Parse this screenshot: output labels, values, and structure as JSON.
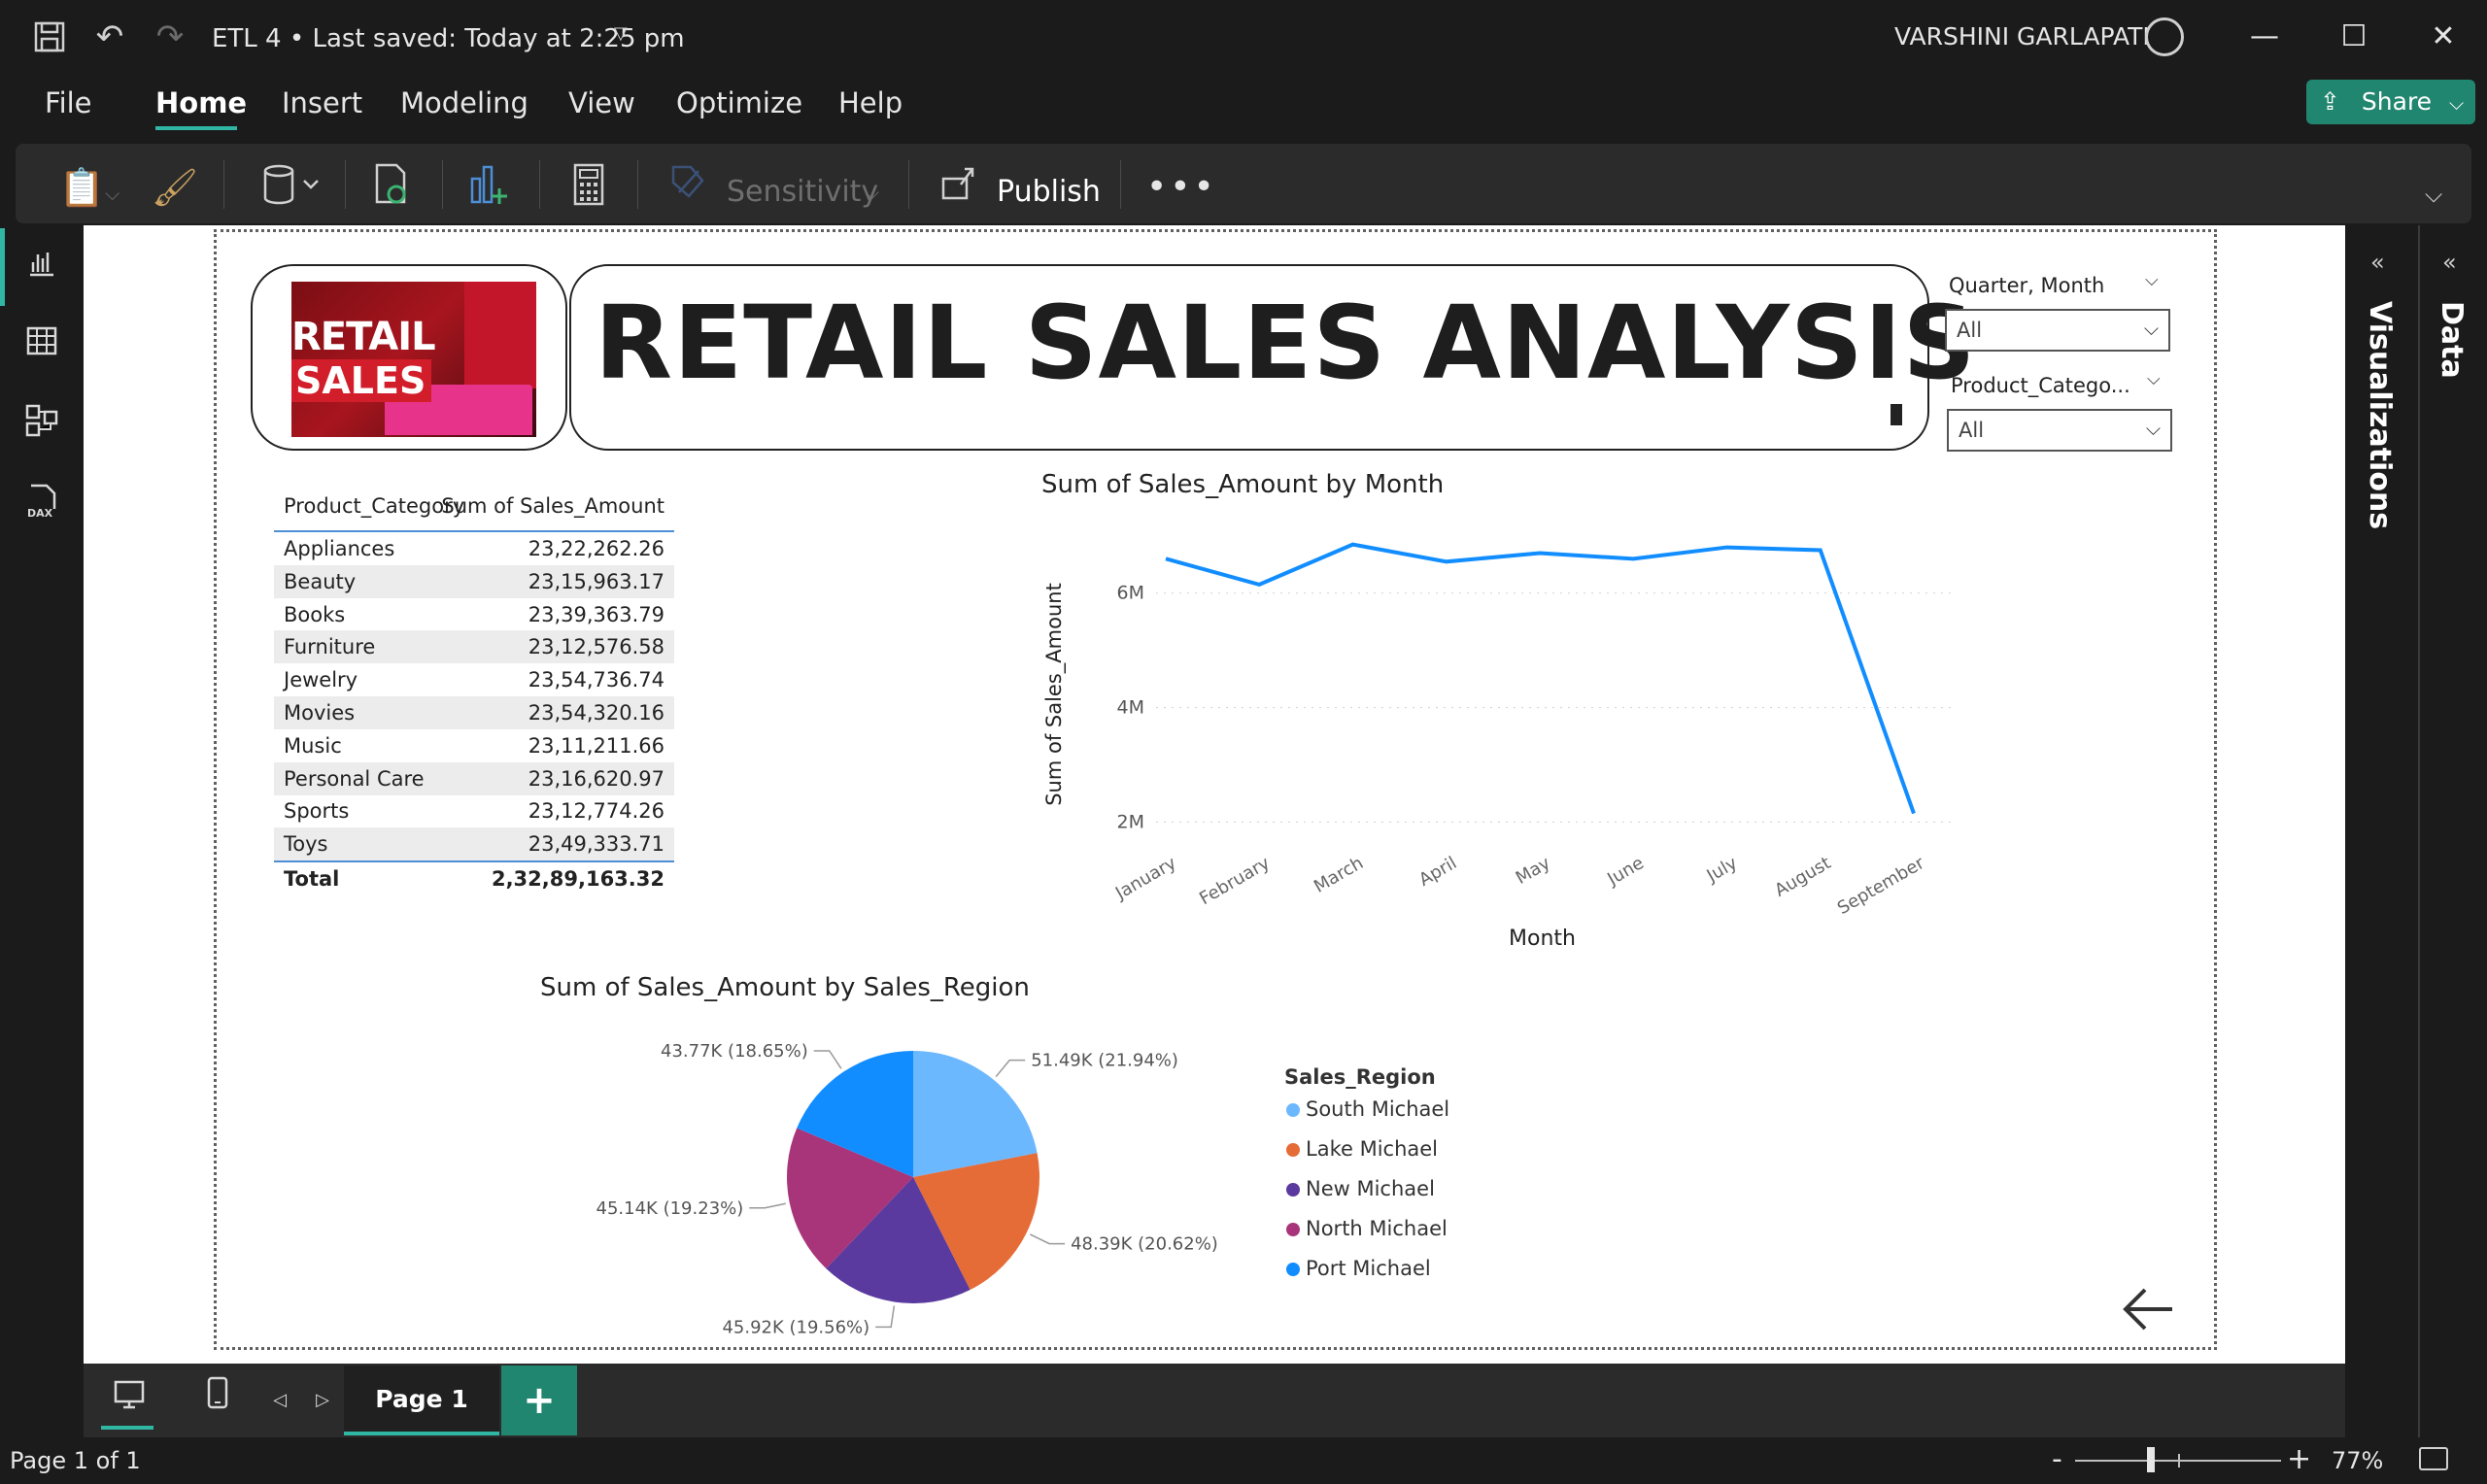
{
  "titlebar": {
    "doc_title": "ETL 4 • Last saved: Today at 2:25 pm",
    "user_name": "VARSHINI GARLAPATI"
  },
  "menu": {
    "file": "File",
    "home": "Home",
    "insert": "Insert",
    "modeling": "Modeling",
    "view": "View",
    "optimize": "Optimize",
    "help": "Help",
    "share": "Share"
  },
  "ribbon": {
    "sensitivity": "Sensitivity",
    "publish": "Publish",
    "more": "•••"
  },
  "report": {
    "title": "RETAIL SALES ANALYSIS",
    "logo_line1": "RETAIL",
    "logo_line2": "SALES"
  },
  "slicers": [
    {
      "label": "Quarter, Month",
      "value": "All"
    },
    {
      "label": "Product_Catego...",
      "value": "All"
    }
  ],
  "table": {
    "headers": [
      "Product_Category",
      "Sum of Sales_Amount"
    ],
    "rows": [
      [
        "Appliances",
        "23,22,262.26"
      ],
      [
        "Beauty",
        "23,15,963.17"
      ],
      [
        "Books",
        "23,39,363.79"
      ],
      [
        "Furniture",
        "23,12,576.58"
      ],
      [
        "Jewelry",
        "23,54,736.74"
      ],
      [
        "Movies",
        "23,54,320.16"
      ],
      [
        "Music",
        "23,11,211.66"
      ],
      [
        "Personal Care",
        "23,16,620.97"
      ],
      [
        "Sports",
        "23,12,774.26"
      ],
      [
        "Toys",
        "23,49,333.71"
      ]
    ],
    "total_label": "Total",
    "total_value": "2,32,89,163.32"
  },
  "chart_data": [
    {
      "type": "line",
      "title": "Sum of Sales_Amount by Month",
      "xlabel": "Month",
      "ylabel": "Sum of Sales_Amount",
      "categories": [
        "January",
        "February",
        "March",
        "April",
        "May",
        "June",
        "July",
        "August",
        "September"
      ],
      "values": [
        6.6,
        6.15,
        6.85,
        6.55,
        6.7,
        6.6,
        6.8,
        6.75,
        2.15
      ],
      "unit": "M",
      "yticks": [
        "2M",
        "4M",
        "6M"
      ],
      "ylim": [
        1.6,
        7.2
      ],
      "color": "#118dff",
      "grid": true
    },
    {
      "type": "pie",
      "title": "Sum of Sales_Amount by Sales_Region",
      "legend_title": "Sales_Region",
      "slices": [
        {
          "name": "South Michael",
          "value": 51.49,
          "label": "51.49K (21.94%)",
          "color": "#6cb8ff"
        },
        {
          "name": "Lake Michael",
          "value": 48.39,
          "label": "48.39K (20.62%)",
          "color": "#e66c37"
        },
        {
          "name": "New Michael",
          "value": 45.92,
          "label": "45.92K (19.56%)",
          "color": "#5a3a9e"
        },
        {
          "name": "North Michael",
          "value": 45.14,
          "label": "45.14K (19.23%)",
          "color": "#a8357a"
        },
        {
          "name": "Port Michael",
          "value": 43.77,
          "label": "43.77K (18.65%)",
          "color": "#118dff"
        }
      ]
    }
  ],
  "panes": {
    "visualizations": "Visualizations",
    "data": "Data"
  },
  "tabs": {
    "page1": "Page 1",
    "add": "+"
  },
  "status": {
    "page": "Page 1 of 1",
    "zoom": "77%"
  },
  "colors": {
    "accent": "#2fb7a4",
    "share_bg": "#21866f"
  }
}
